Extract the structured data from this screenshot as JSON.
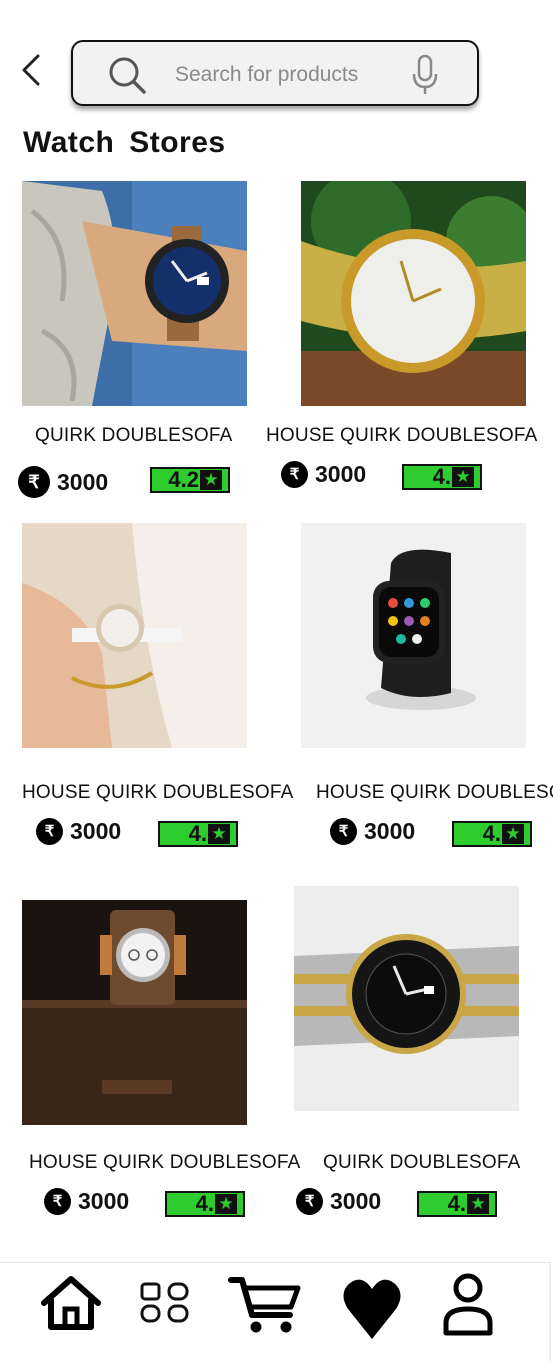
{
  "search": {
    "placeholder": "Search for products"
  },
  "section": {
    "title": "Watch  Stores"
  },
  "products": [
    {
      "name": "QUIRK DOUBLESOFA",
      "price": "3000",
      "rating": "4.2",
      "currency": "₹"
    },
    {
      "name": "HOUSE  QUIRK DOUBLESOFA",
      "price": "3000",
      "rating": "4.",
      "currency": "₹"
    },
    {
      "name": "HOUSE  QUIRK DOUBLESOFA",
      "price": "3000",
      "rating": "4.",
      "currency": "₹"
    },
    {
      "name": "HOUSE  QUIRK DOUBLESOFA",
      "price": "3000",
      "rating": "4.",
      "currency": "₹"
    },
    {
      "name": "HOUSE  QUIRK DOUBLESOFA",
      "price": "3000",
      "rating": "4.",
      "currency": "₹"
    },
    {
      "name": "QUIRK DOUBLESOFA",
      "price": "3000",
      "rating": "4.",
      "currency": "₹"
    }
  ],
  "icons": {
    "star": "★",
    "nav": [
      "home-icon",
      "categories-icon",
      "cart-icon",
      "heart-icon",
      "profile-icon"
    ]
  },
  "colors": {
    "rating_bg": "#2ecc2e",
    "accent": "#000000"
  }
}
